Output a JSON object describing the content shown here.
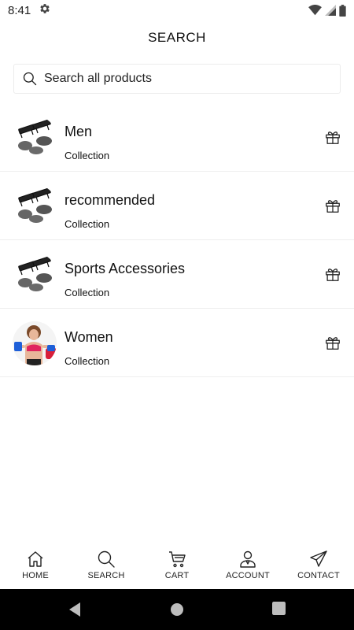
{
  "status_bar": {
    "time": "8:41",
    "icons": [
      "gear-icon",
      "wifi-icon",
      "signal-icon",
      "battery-icon"
    ]
  },
  "header": {
    "title": "SEARCH"
  },
  "search": {
    "placeholder": "Search all products",
    "value": "",
    "icon": "search-icon"
  },
  "collections": [
    {
      "title": "Men",
      "subtitle": "Collection",
      "thumbnail": "push-up-bars-image",
      "action_icon": "gift-icon"
    },
    {
      "title": "recommended",
      "subtitle": "Collection",
      "thumbnail": "push-up-bars-image",
      "action_icon": "gift-icon"
    },
    {
      "title": "Sports Accessories",
      "subtitle": "Collection",
      "thumbnail": "push-up-bars-image",
      "action_icon": "gift-icon"
    },
    {
      "title": "Women",
      "subtitle": "Collection",
      "thumbnail": "woman-with-dumbbells-image",
      "action_icon": "gift-icon"
    }
  ],
  "bottom_nav": [
    {
      "label": "HOME",
      "icon": "home-icon"
    },
    {
      "label": "SEARCH",
      "icon": "search-icon"
    },
    {
      "label": "CART",
      "icon": "cart-icon"
    },
    {
      "label": "ACCOUNT",
      "icon": "account-icon"
    },
    {
      "label": "CONTACT",
      "icon": "paper-plane-icon"
    }
  ],
  "system_nav": [
    "back-icon",
    "home-circle-icon",
    "recents-icon"
  ],
  "colors": {
    "background": "#ffffff",
    "text": "#111111",
    "divider": "#eeeeee",
    "system_bar": "#000000"
  }
}
